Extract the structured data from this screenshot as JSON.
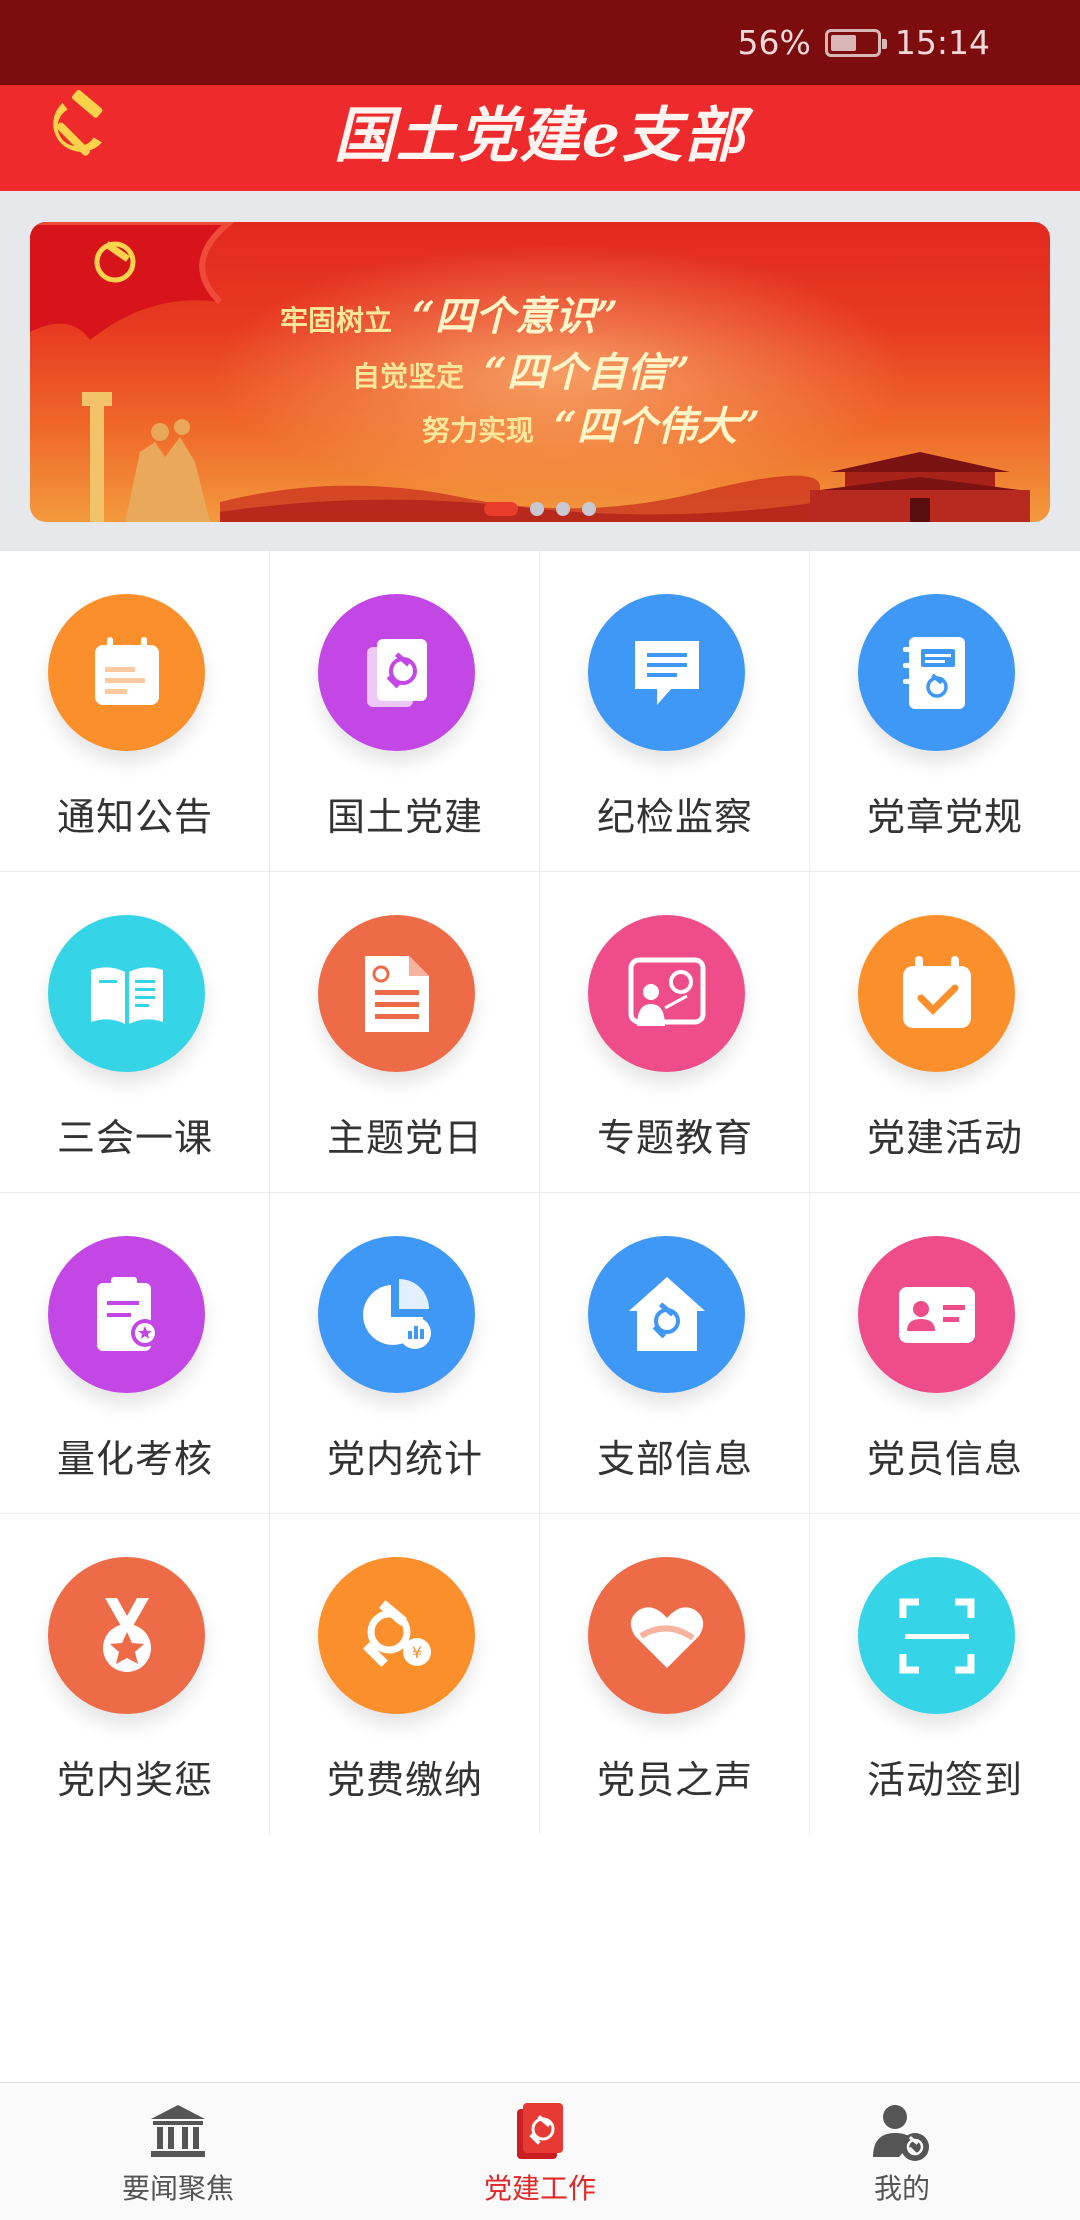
{
  "status_bar": {
    "battery_percent": "56%",
    "battery_level": 0.56,
    "time": "15:14"
  },
  "header": {
    "title": "国土党建e支部",
    "logo_icon": "hammer-sickle-icon"
  },
  "banner": {
    "lines": [
      {
        "lead": "牢固树立",
        "quote": "“四个意识”"
      },
      {
        "lead": "自觉坚定",
        "quote": "“四个自信”"
      },
      {
        "lead": "努力实现",
        "quote": "“四个伟大”"
      }
    ],
    "page_count": 4,
    "active_page": 1
  },
  "grid": {
    "items": [
      {
        "label": "通知公告",
        "icon": "calendar-notice-icon",
        "color": "#fa8f2c"
      },
      {
        "label": "国土党建",
        "icon": "party-book-icon",
        "color": "#c247e4"
      },
      {
        "label": "纪检监察",
        "icon": "chat-document-icon",
        "color": "#3f97f6"
      },
      {
        "label": "党章党规",
        "icon": "party-notebook-icon",
        "color": "#3f97f6"
      },
      {
        "label": "三会一课",
        "icon": "open-book-icon",
        "color": "#35d4e6"
      },
      {
        "label": "主题党日",
        "icon": "party-document-icon",
        "color": "#ee6b48"
      },
      {
        "label": "专题教育",
        "icon": "lecture-board-icon",
        "color": "#ef4d8a"
      },
      {
        "label": "党建活动",
        "icon": "calendar-check-icon",
        "color": "#fa8f2c"
      },
      {
        "label": "量化考核",
        "icon": "clipboard-award-icon",
        "color": "#c247e4"
      },
      {
        "label": "党内统计",
        "icon": "pie-chart-icon",
        "color": "#3f97f6"
      },
      {
        "label": "支部信息",
        "icon": "party-house-icon",
        "color": "#3f97f6"
      },
      {
        "label": "党员信息",
        "icon": "id-card-icon",
        "color": "#ef4d8a"
      },
      {
        "label": "党内奖惩",
        "icon": "medal-icon",
        "color": "#ee6b48"
      },
      {
        "label": "党费缴纳",
        "icon": "party-fee-icon",
        "color": "#fa8f2c"
      },
      {
        "label": "党员之声",
        "icon": "heart-ribbon-icon",
        "color": "#ee6b48"
      },
      {
        "label": "活动签到",
        "icon": "scan-frame-icon",
        "color": "#35d4e6"
      }
    ]
  },
  "bottom_nav": {
    "items": [
      {
        "label": "要闻聚焦",
        "icon": "bank-building-icon",
        "active": false
      },
      {
        "label": "党建工作",
        "icon": "party-book-icon",
        "active": true
      },
      {
        "label": "我的",
        "icon": "user-party-icon",
        "active": false
      }
    ],
    "active_color": "#e02a2a"
  }
}
